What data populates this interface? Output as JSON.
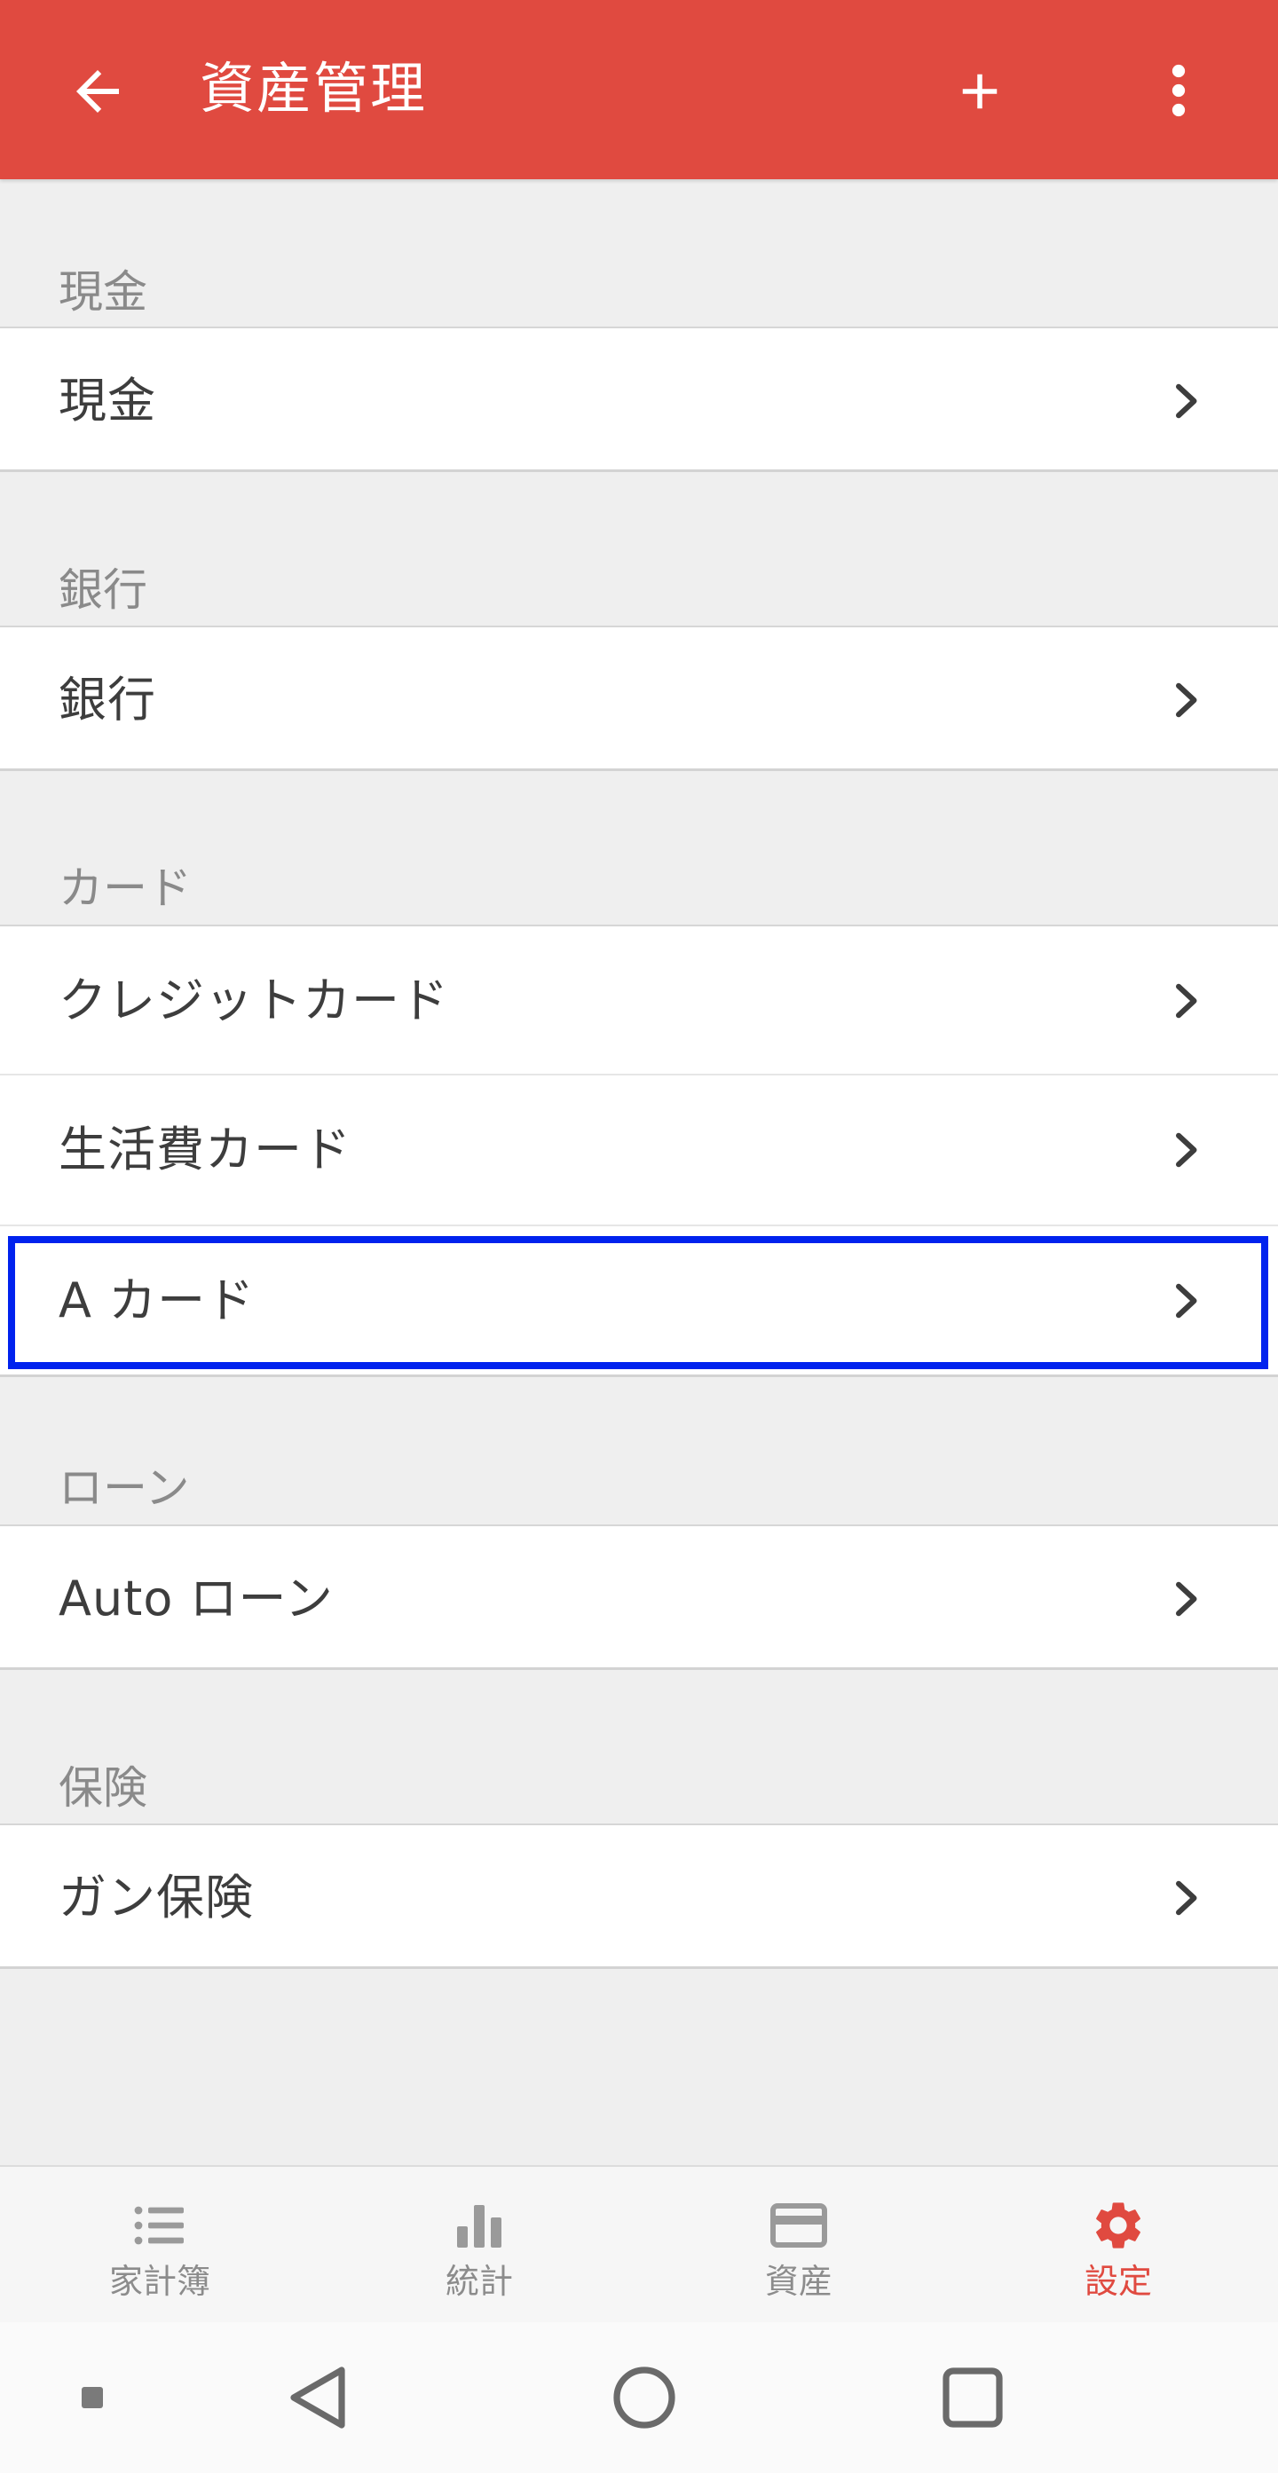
{
  "header": {
    "title": "資産管理"
  },
  "sections": [
    {
      "label": "現金",
      "items": [
        "現金"
      ]
    },
    {
      "label": "銀行",
      "items": [
        "銀行"
      ]
    },
    {
      "label": "カード",
      "items": [
        "クレジットカード",
        "生活費カード",
        "A カード"
      ]
    },
    {
      "label": "ローン",
      "items": [
        "Auto ローン"
      ]
    },
    {
      "label": "保険",
      "items": [
        "ガン保険"
      ]
    }
  ],
  "bottom_nav": {
    "items": [
      {
        "label": "家計簿",
        "icon": "list-icon"
      },
      {
        "label": "統計",
        "icon": "bar-chart-icon"
      },
      {
        "label": "資産",
        "icon": "credit-card-icon"
      },
      {
        "label": "設定",
        "icon": "gear-icon",
        "active": true
      }
    ]
  },
  "colors": {
    "accent": "#e04a40",
    "highlight_border": "#0022ee",
    "background": "#efefef"
  }
}
